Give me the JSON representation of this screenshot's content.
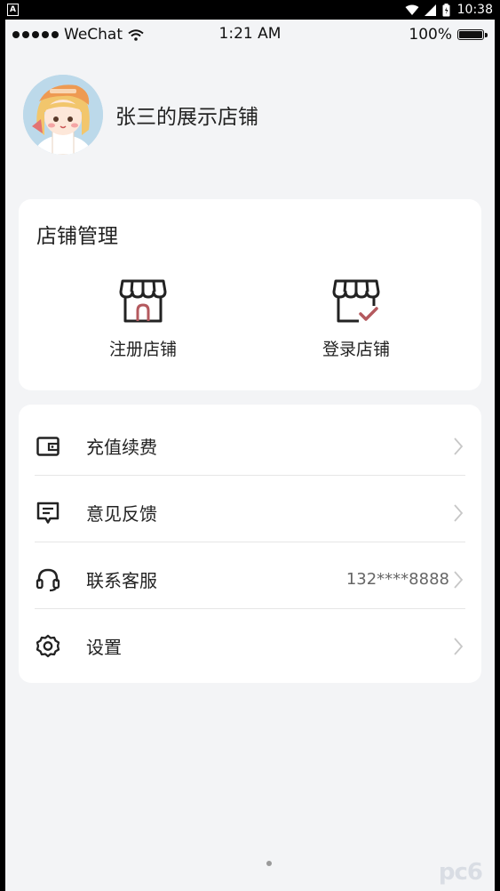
{
  "android_status": {
    "app_glyph": "A",
    "time": "10:38",
    "icons": [
      "wifi-icon",
      "signal-icon",
      "battery-icon"
    ]
  },
  "ios_status": {
    "carrier": "WeChat",
    "time": "1:21 AM",
    "battery": "100%"
  },
  "profile": {
    "shop_name": "张三的展示店铺"
  },
  "store_management": {
    "title": "店铺管理",
    "register_label": "注册店铺",
    "login_label": "登录店铺"
  },
  "menu": {
    "items": [
      {
        "label": "充值续费",
        "value": "",
        "icon": "wallet-icon"
      },
      {
        "label": "意见反馈",
        "value": "",
        "icon": "feedback-icon"
      },
      {
        "label": "联系客服",
        "value": "132****8888",
        "icon": "headset-icon"
      },
      {
        "label": "设置",
        "value": "",
        "icon": "gear-icon"
      }
    ]
  },
  "watermark": "pc6",
  "colors": {
    "background": "#f3f4f6",
    "card": "#ffffff",
    "accent_red": "#b4595e",
    "text": "#222222"
  }
}
